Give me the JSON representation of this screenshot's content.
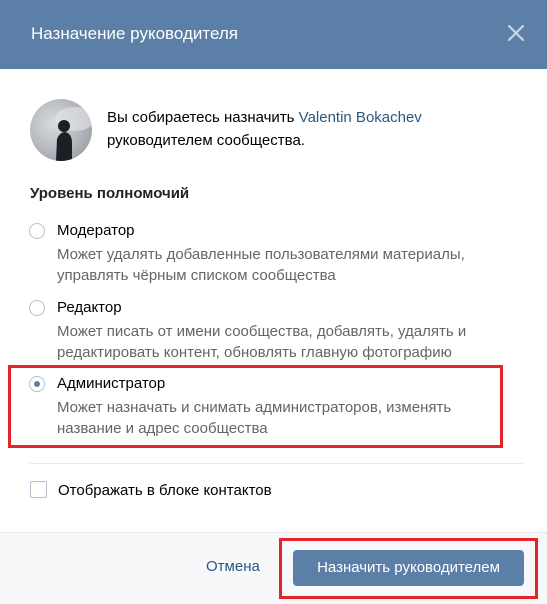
{
  "header": {
    "title": "Назначение руководителя",
    "close_icon": "close-icon"
  },
  "intro": {
    "prefix": "Вы собираетесь назначить ",
    "user_name": "Valentin Bokachev",
    "suffix": "руководителем сообщества."
  },
  "permissions": {
    "title": "Уровень полномочий",
    "options": [
      {
        "title": "Модератор",
        "description": "Может удалять добавленные пользователями материалы, управлять чёрным списком сообщества",
        "selected": false
      },
      {
        "title": "Редактор",
        "description": "Может писать от имени сообщества, добавлять, удалять и редактировать контент, обновлять главную фотографию",
        "selected": false
      },
      {
        "title": "Администратор",
        "description": "Может назначать и снимать администраторов, изменять название и адрес сообщества",
        "selected": true
      }
    ]
  },
  "contacts": {
    "label": "Отображать в блоке контактов",
    "checked": false
  },
  "footer": {
    "cancel_label": "Отмена",
    "submit_label": "Назначить руководителем"
  },
  "colors": {
    "header_bg": "#5b7fa6",
    "link": "#2a5885",
    "highlight": "#e6222b",
    "footer_bg": "#f7f8fa"
  }
}
